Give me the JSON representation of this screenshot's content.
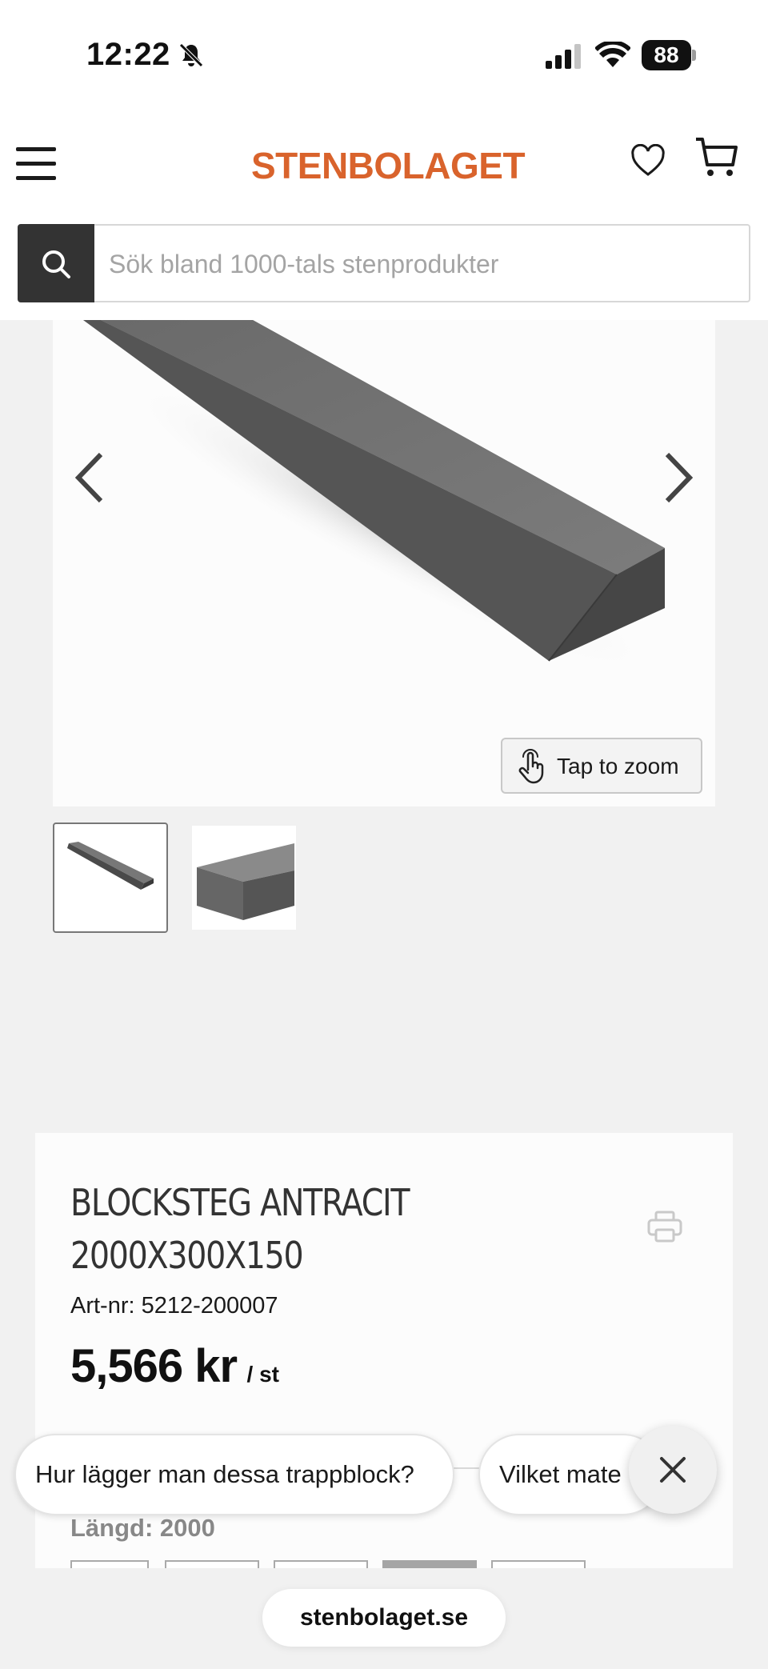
{
  "status_bar": {
    "time": "12:22",
    "battery": "88",
    "icons": [
      "bell-muted-icon",
      "cellular-signal-icon",
      "wifi-icon",
      "battery-icon"
    ]
  },
  "header": {
    "logo": "STENBOLAGET",
    "logo_color": "#d9632c",
    "icons": [
      "hamburger-menu-icon",
      "heart-icon",
      "cart-icon"
    ]
  },
  "search": {
    "placeholder": "Sök bland 1000-tals stenprodukter",
    "icon": "search-icon"
  },
  "gallery": {
    "zoom_label": "Tap to zoom",
    "thumbnail_count": 2,
    "selected_thumbnail": 1,
    "icons": [
      "chevron-left-icon",
      "chevron-right-icon",
      "touch-hand-icon"
    ]
  },
  "product": {
    "title_line1": "BLOCKSTEG ANTRACIT",
    "title_line2": "2000X300X150",
    "art_nr": "Art-nr: 5212-200007",
    "price": "5,566 kr",
    "unit": "/ st",
    "length_label": "Längd: 2000",
    "print_icon": "printer-icon"
  },
  "chat_suggestions": {
    "chip1": "Hur lägger man dessa trappblock?",
    "chip2": "Vilket mate",
    "close_icon": "close-icon"
  },
  "browser": {
    "url": "stenbolaget.se"
  }
}
